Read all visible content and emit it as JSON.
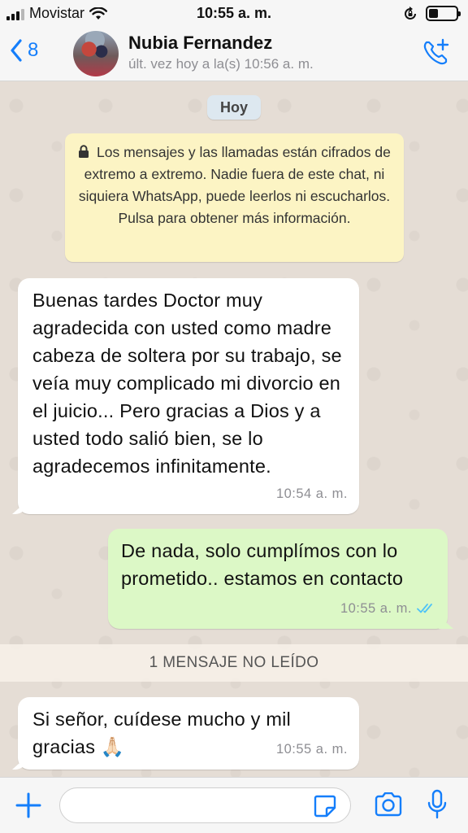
{
  "status_bar": {
    "carrier": "Movistar",
    "time": "10:55 a. m.",
    "battery_level": 0.35,
    "icons": [
      "signal-icon",
      "wifi-icon",
      "rotation-lock-icon",
      "battery-icon"
    ]
  },
  "header": {
    "back_count": "8",
    "contact_name": "Nubia Fernandez",
    "last_seen": "últ. vez hoy a la(s) 10:56 a. m.",
    "accent_color": "#147efb"
  },
  "chat": {
    "day_label": "Hoy",
    "encryption_notice": "Los mensajes y las llamadas están cifrados de extremo a extremo. Nadie fuera de este chat, ni siquiera WhatsApp, puede leerlos ni escucharlos. Pulsa para obtener más información.",
    "messages": [
      {
        "direction": "incoming",
        "text": "Buenas tardes Doctor muy agradecida con usted como madre cabeza de soltera por su trabajo, se veía muy complicado mi divorcio en el juicio... Pero gracias a Dios y a usted todo salió bien, se lo agradecemos infinitamente.",
        "time": "10:54 a. m."
      },
      {
        "direction": "outgoing",
        "text": "De nada, solo cumplímos con lo prometido.. estamos en contacto",
        "time": "10:55 a. m.",
        "status": "read",
        "status_icon": "double-check-icon",
        "status_color": "#4fc3f7"
      },
      {
        "direction": "incoming",
        "text": "Si señor, cuídese mucho y mil gracias 🙏🏻",
        "time": "10:55 a. m."
      }
    ],
    "unread_divider": "1 MENSAJE NO LEÍDO"
  },
  "input_bar": {
    "placeholder": "",
    "value": "",
    "icons": [
      "plus-icon",
      "sticker-icon",
      "camera-icon",
      "microphone-icon"
    ]
  }
}
